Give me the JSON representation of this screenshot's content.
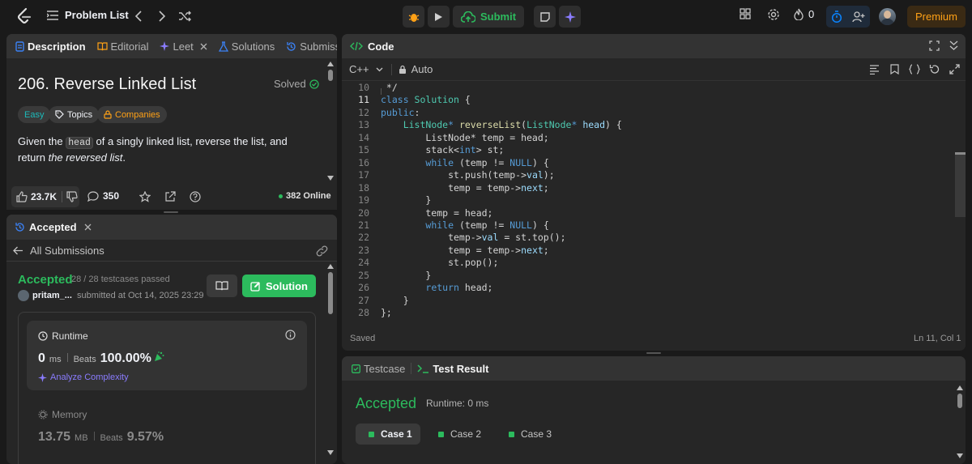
{
  "topbar": {
    "problem_list": "Problem List",
    "submit": "Submit",
    "streak": "0",
    "premium": "Premium"
  },
  "colors": {
    "accent": "#ffa116",
    "green": "#2cbb5d",
    "blue": "#0a84ff",
    "bg": "#1a1a1a",
    "panel": "#262626"
  },
  "description_panel": {
    "tabs": [
      {
        "label": "Description",
        "icon": "document-icon"
      },
      {
        "label": "Editorial",
        "icon": "book-icon"
      },
      {
        "label": "Leet",
        "icon": "sparkle-icon"
      },
      {
        "label": "Solutions",
        "icon": "flask-icon"
      },
      {
        "label": "Submiss",
        "icon": "history-icon"
      }
    ],
    "title": "206. Reverse Linked List",
    "solved": "Solved",
    "tags": {
      "difficulty": "Easy",
      "topics": "Topics",
      "companies": "Companies"
    },
    "text_1": "Given the ",
    "code_head": "head",
    "text_2": " of a singly linked list, reverse the list, and return ",
    "text_em": "the reversed list",
    "text_3": ".",
    "likes": "23.7K",
    "comments": "350",
    "online": "382 Online"
  },
  "submission_panel": {
    "tab": "Accepted",
    "back": "All Submissions",
    "status": "Accepted",
    "testcases": "28 / 28 testcases passed",
    "user": "pritam_...",
    "submitted": "submitted at Oct 14, 2025 23:29",
    "solution_btn": "Solution",
    "runtime": {
      "label": "Runtime",
      "value": "0",
      "unit": "ms",
      "beats_label": "Beats",
      "beats": "100.00%",
      "analyze": "Analyze Complexity"
    },
    "memory": {
      "label": "Memory",
      "value": "13.75",
      "unit": "MB",
      "beats_label": "Beats",
      "beats": "9.57%"
    }
  },
  "code_panel": {
    "title": "Code",
    "language": "C++",
    "mode": "Auto",
    "status": "Saved",
    "cursor": "Ln 11, Col 1",
    "lines": [
      {
        "n": "10",
        "t": [
          [
            "pl",
            " */"
          ]
        ]
      },
      {
        "n": "11",
        "t": [
          [
            "kw",
            "class "
          ],
          [
            "ty",
            "Solution"
          ],
          [
            "pl",
            " {"
          ]
        ]
      },
      {
        "n": "12",
        "t": [
          [
            "kw",
            "public"
          ],
          [
            "pl",
            ":"
          ]
        ]
      },
      {
        "n": "13",
        "t": [
          [
            "pl",
            "    "
          ],
          [
            "ty",
            "ListNode"
          ],
          [
            "kw",
            "* "
          ],
          [
            "fn",
            "reverseList"
          ],
          [
            "pl",
            "("
          ],
          [
            "ty",
            "ListNode"
          ],
          [
            "kw",
            "* "
          ],
          [
            "va",
            "head"
          ],
          [
            "pl",
            ") {"
          ]
        ]
      },
      {
        "n": "14",
        "t": [
          [
            "pl",
            "        ListNode* temp = head;"
          ]
        ]
      },
      {
        "n": "15",
        "t": [
          [
            "pl",
            "        stack<"
          ],
          [
            "kw",
            "int"
          ],
          [
            "pl",
            "> st;"
          ]
        ]
      },
      {
        "n": "16",
        "t": [
          [
            "pl",
            "        "
          ],
          [
            "kw",
            "while"
          ],
          [
            "pl",
            " (temp != "
          ],
          [
            "kw",
            "NULL"
          ],
          [
            "pl",
            ") {"
          ]
        ]
      },
      {
        "n": "17",
        "t": [
          [
            "pl",
            "            st.push(temp->"
          ],
          [
            "va",
            "val"
          ],
          [
            "pl",
            ");"
          ]
        ]
      },
      {
        "n": "18",
        "t": [
          [
            "pl",
            "            temp = temp->"
          ],
          [
            "va",
            "next"
          ],
          [
            "pl",
            ";"
          ]
        ]
      },
      {
        "n": "19",
        "t": [
          [
            "pl",
            "        }"
          ]
        ]
      },
      {
        "n": "20",
        "t": [
          [
            "pl",
            "        temp = head;"
          ]
        ]
      },
      {
        "n": "21",
        "t": [
          [
            "pl",
            "        "
          ],
          [
            "kw",
            "while"
          ],
          [
            "pl",
            " (temp != "
          ],
          [
            "kw",
            "NULL"
          ],
          [
            "pl",
            ") {"
          ]
        ]
      },
      {
        "n": "22",
        "t": [
          [
            "pl",
            "            temp->"
          ],
          [
            "va",
            "val"
          ],
          [
            "pl",
            " = st.top();"
          ]
        ]
      },
      {
        "n": "23",
        "t": [
          [
            "pl",
            "            temp = temp->"
          ],
          [
            "va",
            "next"
          ],
          [
            "pl",
            ";"
          ]
        ]
      },
      {
        "n": "24",
        "t": [
          [
            "pl",
            "            st.pop();"
          ]
        ]
      },
      {
        "n": "25",
        "t": [
          [
            "pl",
            "        }"
          ]
        ]
      },
      {
        "n": "26",
        "t": [
          [
            "pl",
            "        "
          ],
          [
            "kw",
            "return"
          ],
          [
            "pl",
            " head;"
          ]
        ]
      },
      {
        "n": "27",
        "t": [
          [
            "pl",
            "    }"
          ]
        ]
      },
      {
        "n": "28",
        "t": [
          [
            "pl",
            "};"
          ]
        ]
      }
    ]
  },
  "result_panel": {
    "tab_testcase": "Testcase",
    "tab_result": "Test Result",
    "status": "Accepted",
    "runtime": "Runtime: 0 ms",
    "cases": [
      "Case 1",
      "Case 2",
      "Case 3"
    ]
  }
}
